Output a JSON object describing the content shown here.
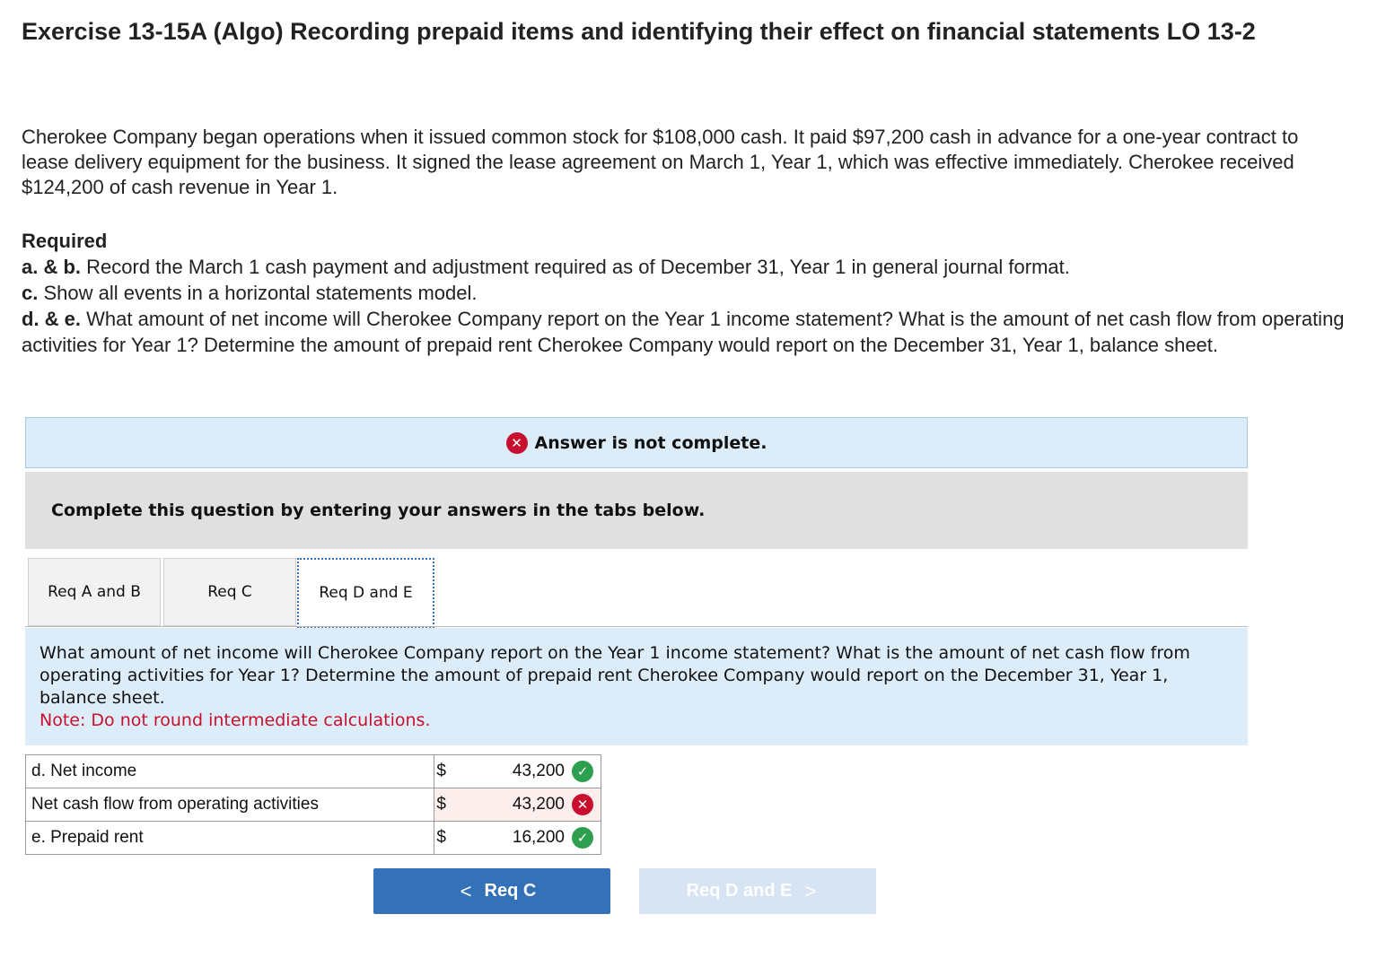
{
  "page": {
    "title": "Exercise 13-15A (Algo) Recording prepaid items and identifying their effect on financial statements LO 13-2",
    "intro": "Cherokee Company began operations when it issued common stock for $108,000 cash. It paid $97,200 cash in advance for a one-year contract to lease delivery equipment for the business. It signed the lease agreement on March 1, Year 1, which was effective immediately. Cherokee received $124,200 of cash revenue in Year 1."
  },
  "required": {
    "heading": "Required",
    "items": [
      {
        "label": "a. & b.",
        "text": "Record the March 1 cash payment and adjustment required as of December 31, Year 1 in general journal format."
      },
      {
        "label": "c.",
        "text": "Show all events in a horizontal statements model."
      },
      {
        "label": "d. & e.",
        "text": "What amount of net income will Cherokee Company report on the Year 1 income statement? What is the amount of net cash flow from operating activities for Year 1? Determine the amount of prepaid rent Cherokee Company would report on the December 31, Year 1, balance sheet."
      }
    ]
  },
  "banner": {
    "icon": "x-circle-icon",
    "text": "Answer is not complete."
  },
  "instruction": "Complete this question by entering your answers in the tabs below.",
  "tabs": [
    {
      "label": "Req A and B"
    },
    {
      "label": "Req C"
    },
    {
      "label": "Req D and E",
      "active": true
    }
  ],
  "question": {
    "text": "What amount of net income will Cherokee Company report on the Year 1 income statement? What is the amount of net cash flow from operating activities for Year 1? Determine the amount of prepaid rent Cherokee Company would report on the December 31, Year 1, balance sheet.",
    "note": "Note: Do not round intermediate calculations."
  },
  "answers": [
    {
      "label": "d. Net income",
      "currency": "$",
      "value": "43,200",
      "status": "correct"
    },
    {
      "label": "Net cash flow from operating activities",
      "currency": "$",
      "value": "43,200",
      "status": "incorrect"
    },
    {
      "label": "e. Prepaid rent",
      "currency": "$",
      "value": "16,200",
      "status": "correct"
    }
  ],
  "nav": {
    "prev_label": "Req C",
    "next_label": "Req D and E"
  },
  "colors": {
    "correct": "#2e9e4f",
    "incorrect": "#c8102e",
    "primary_button": "#3471b8",
    "disabled_button": "#d7e4f3",
    "info_panel": "#dcedf9"
  }
}
